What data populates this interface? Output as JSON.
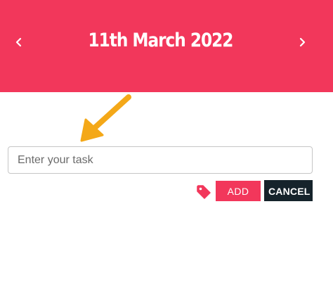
{
  "header": {
    "date_title": "11th March 2022",
    "prev_icon": "chevron-left-icon",
    "next_icon": "chevron-right-icon",
    "background_color": "#f2375b"
  },
  "annotation": {
    "icon": "arrow-pointer-icon",
    "color": "#f4a818"
  },
  "task_form": {
    "input_value": "",
    "input_placeholder": "Enter your task",
    "tag_icon": "tag-icon",
    "add_label": "ADD",
    "cancel_label": "CANCEL",
    "add_color": "#f2375b",
    "cancel_color": "#16232b"
  }
}
